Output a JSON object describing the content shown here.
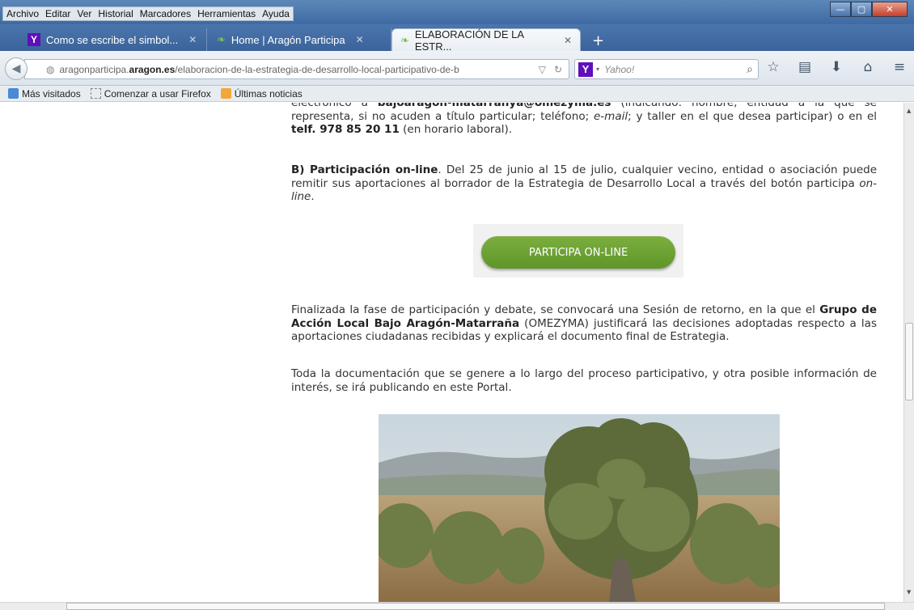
{
  "menu": [
    "Archivo",
    "Editar",
    "Ver",
    "Historial",
    "Marcadores",
    "Herramientas",
    "Ayuda"
  ],
  "tabs": [
    {
      "title": "Como se escribe el simbol...",
      "icon": "yahoo-favicon-icon"
    },
    {
      "title": "Home | Aragón Participa",
      "icon": "aragon-favicon-icon"
    },
    {
      "title": "ELABORACIÓN DE LA ESTR...",
      "icon": "aragon-favicon-icon",
      "active": true
    }
  ],
  "url": {
    "prefix": "aragonparticipa.",
    "host": "aragon.es",
    "path": "/elaboracion-de-la-estrategia-de-desarrollo-local-participativo-de-b"
  },
  "search": {
    "engine": "Y",
    "placeholder": "Yahoo!"
  },
  "bookmarks": [
    "Más visitados",
    "Comenzar a usar Firefox",
    "Últimas noticias"
  ],
  "content": {
    "p1_a": "electrónico a ",
    "p1_b": "bajoaragon-matarranya@omezyma.es",
    "p1_c": " (indicando: nombre, entidad a la que se representa, si no acuden a título particular; teléfono; ",
    "p1_email": "e-mail",
    "p1_d": "; y taller en el que desea participar) o en el ",
    "p1_tel": "telf. 978 85 20 11",
    "p1_e": " (en horario laboral).",
    "p2_bold": "B) Participación on-line",
    "p2_text": ". Del 25 de junio al 15 de julio, cualquier vecino, entidad o asociación puede remitir sus aportaciones al borrador de la Estrategia de Desarrollo Local a través del botón participa ",
    "p2_italic": "on-line",
    "p2_end": ".",
    "cta": "PARTICIPA ON-LINE",
    "p3_a": "Finalizada la fase de participación y debate, se convocará una Sesión de retorno, en la que el ",
    "p3_bold": "Grupo de Acción Local Bajo Aragón-Matarraña",
    "p3_b": " (OMEZYMA) justificará las decisiones adoptadas respecto a las aportaciones ciudadanas recibidas y explicará el documento final de Estrategia.",
    "p4": "Toda la documentación que se genere a lo largo del proceso participativo, y otra posible información de interés, se irá publicando en este Portal."
  }
}
